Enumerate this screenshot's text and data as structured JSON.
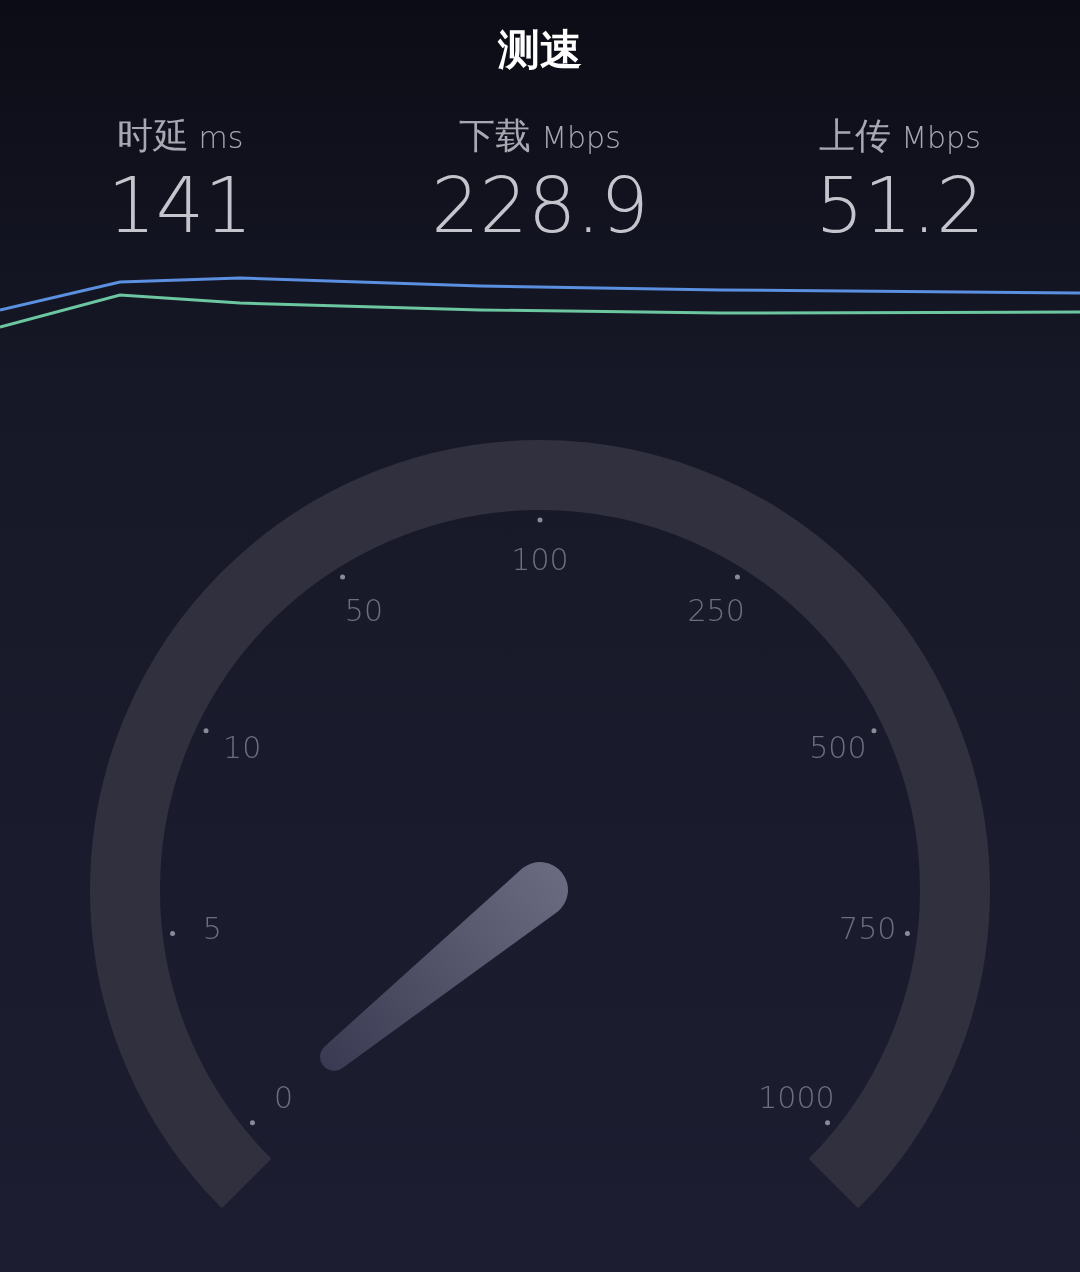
{
  "title": "测速",
  "stats": [
    {
      "label": "时延",
      "unit": "ms",
      "value": "141"
    },
    {
      "label": "下载",
      "unit": "Mbps",
      "value": "228.9"
    },
    {
      "label": "上传",
      "unit": "Mbps",
      "value": "51.2"
    }
  ],
  "gauge": {
    "ticks": [
      "0",
      "5",
      "10",
      "50",
      "100",
      "250",
      "500",
      "750",
      "1000"
    ]
  }
}
